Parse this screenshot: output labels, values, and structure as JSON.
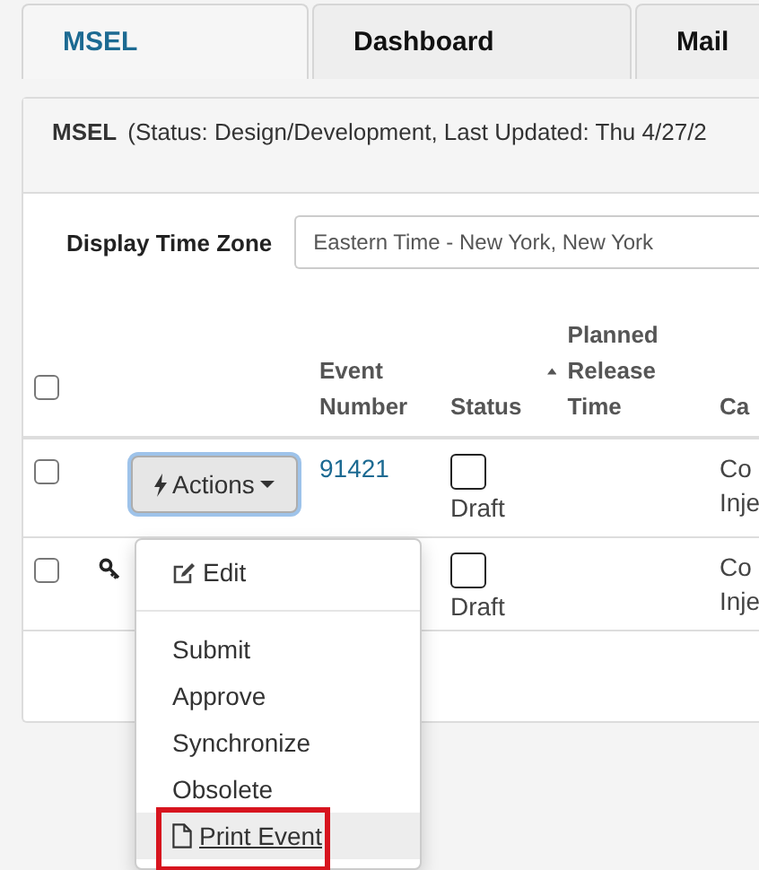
{
  "tabs": [
    {
      "label": "MSEL",
      "selected": true
    },
    {
      "label": "Dashboard",
      "selected": false
    },
    {
      "label": "Mail",
      "selected": false
    }
  ],
  "panel": {
    "title": "MSEL",
    "subtitle": "(Status: Design/Development, Last Updated: Thu 4/27/2"
  },
  "time_zone": {
    "label": "Display Time Zone",
    "value": "Eastern Time - New York, New York"
  },
  "table": {
    "select_all_checked": false,
    "columns": [
      {
        "label": "Event Number",
        "sorted": false
      },
      {
        "label": "Status",
        "sorted": false
      },
      {
        "label": "Planned Release Time",
        "sorted": true
      },
      {
        "label": "Ca",
        "sorted": false
      }
    ],
    "rows": [
      {
        "checked": false,
        "locked": false,
        "actions": {
          "label": "Actions",
          "focused": true
        },
        "event_number": "91421",
        "status": "Draft",
        "category": [
          "Co",
          "Inje"
        ]
      },
      {
        "checked": false,
        "locked": true,
        "status": "Draft",
        "category": [
          "Co",
          "Inje"
        ]
      }
    ]
  },
  "menu": {
    "items": [
      {
        "kind": "edit",
        "label": "Edit",
        "hovered": false,
        "annotated": false
      },
      {
        "kind": "divider"
      },
      {
        "kind": "plain",
        "label": "Submit",
        "hovered": false,
        "annotated": false
      },
      {
        "kind": "plain",
        "label": "Approve",
        "hovered": false,
        "annotated": false
      },
      {
        "kind": "plain",
        "label": "Synchronize",
        "hovered": false,
        "annotated": false
      },
      {
        "kind": "plain",
        "label": "Obsolete",
        "hovered": false,
        "annotated": false
      },
      {
        "kind": "print",
        "label": "Print Event",
        "hovered": true,
        "annotated": true
      }
    ]
  }
}
